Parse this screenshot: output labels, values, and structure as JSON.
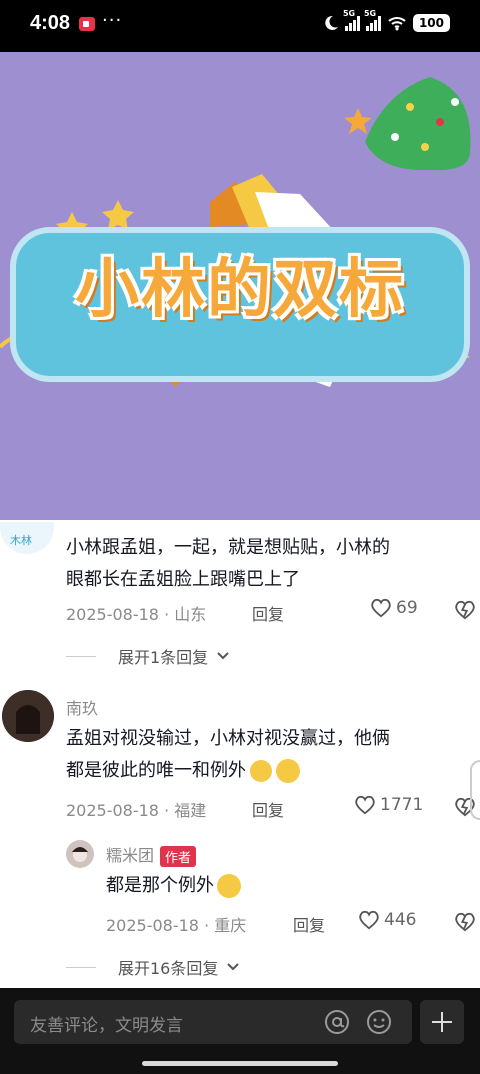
{
  "status_bar": {
    "time": "4:08",
    "dots": "···",
    "signal1_label": "5G",
    "signal2_label": "5G",
    "battery": "100"
  },
  "video": {
    "title": "小林的双标",
    "colors": {
      "background": "#9e8fd0",
      "banner": "#60c3dd",
      "title": "#f6a93a"
    }
  },
  "comments": [
    {
      "text_line1": "小林跟孟姐，一起，就是想贴贴，小林的",
      "text_line2": "眼都长在孟姐脸上跟嘴巴上了",
      "date_loc": "2025-08-18 · 山东",
      "reply": "回复",
      "likes": "69",
      "expand": "展开1条回复"
    },
    {
      "user": "南玖",
      "text_line1": "孟姐对视没输过，小林对视没赢过，他俩",
      "text_line2": "都是彼此的唯一和例外",
      "date_loc": "2025-08-18 · 福建",
      "reply": "回复",
      "likes": "1771",
      "sub_reply": {
        "user": "糯米团",
        "badge": "作者",
        "text": "都是那个例外",
        "date_loc": "2025-08-18 · 重庆",
        "reply": "回复",
        "likes": "446"
      },
      "expand": "展开16条回复"
    }
  ],
  "input": {
    "placeholder": "友善评论，文明发言"
  }
}
